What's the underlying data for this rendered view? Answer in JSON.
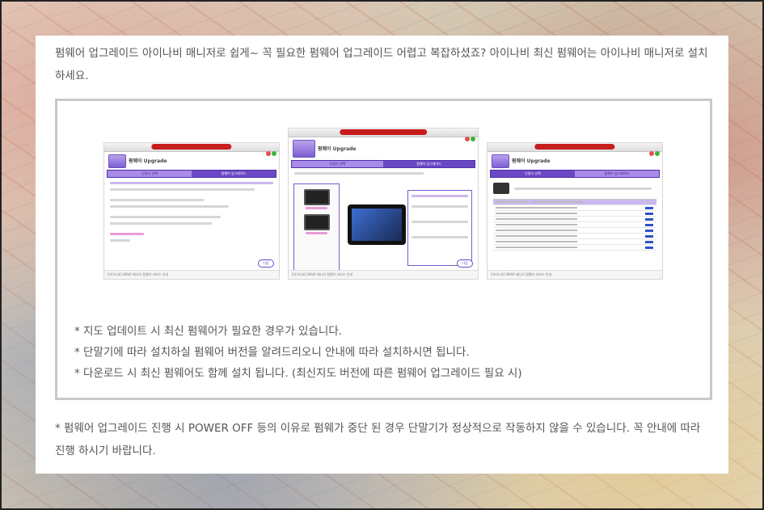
{
  "intro": "펌웨어 업그레이드 아이나비 매니저로 쉽게~ 꼭 필요한 펌웨어 업그레이드 어렵고 복잡하셨죠? 아이나비 최신 펌웨어는 아이나비 매니저로 설치하세요.",
  "screenshots": [
    {
      "app_title": "펌웨어 Upgrade",
      "steps": [
        "단말기 선택",
        "펌웨어 업그레이드"
      ],
      "next_label": "다음",
      "footer": "[아이나비] iNAVI 매니저 펌웨어 서비스 안내"
    },
    {
      "app_title": "펌웨어 Upgrade",
      "steps": [
        "단말기 선택",
        "펌웨어 업그레이드"
      ],
      "next_label": "다음",
      "footer": "[아이나비] iNAVI 매니저 펌웨어 서비스 안내"
    },
    {
      "app_title": "펌웨어 Upgrade",
      "steps": [
        "단말기 선택",
        "펌웨어 업그레이드"
      ],
      "next_label": "",
      "footer": "[아이나비] iNAVI 매니저 펌웨어 서비스 안내"
    }
  ],
  "notes": [
    "* 지도 업데이트 시 최신 펌웨어가 필요한 경우가 있습니다.",
    "* 단말기에 따라 설치하실 펌웨어 버전을 알려드리오니 안내에 따라 설치하시면 됩니다.",
    "* 다운로드 시 최신 펌웨어도 함께 설치 됩니다. (최신지도 버전에 따른 펌웨어 업그레이드 필요 시)"
  ],
  "outro": "* 펌웨어 업그레이드 진행 시 POWER OFF 등의 이유로 펌웨가 중단 된 경우 단말기가 정상적으로 작동하지 않을 수 있습니다. 꼭 안내에 따라 진행 하시기 바랍니다.",
  "colors": {
    "accent": "#6b48c6",
    "red": "#c81d1d",
    "text": "#555555"
  }
}
